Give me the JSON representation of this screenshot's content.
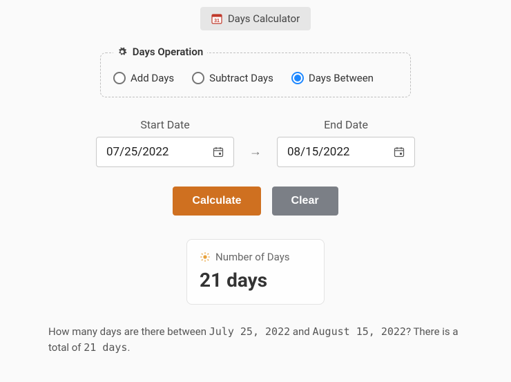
{
  "tab": {
    "label": "Days Calculator"
  },
  "operation": {
    "legend": "Days Operation",
    "options": {
      "add": "Add Days",
      "subtract": "Subtract Days",
      "between": "Days Between"
    },
    "selected": "between"
  },
  "fields": {
    "start": {
      "label": "Start Date",
      "value": "07/25/2022"
    },
    "end": {
      "label": "End Date",
      "value": "08/15/2022"
    }
  },
  "buttons": {
    "calculate": "Calculate",
    "clear": "Clear"
  },
  "result": {
    "title": "Number of Days",
    "value": "21 days"
  },
  "explain": {
    "prefix": "How many days are there between ",
    "date1": "July 25, 2022",
    "mid": " and ",
    "date2": "August 15, 2022",
    "after": "? There is a total of ",
    "count": "21 days",
    "end": "."
  }
}
